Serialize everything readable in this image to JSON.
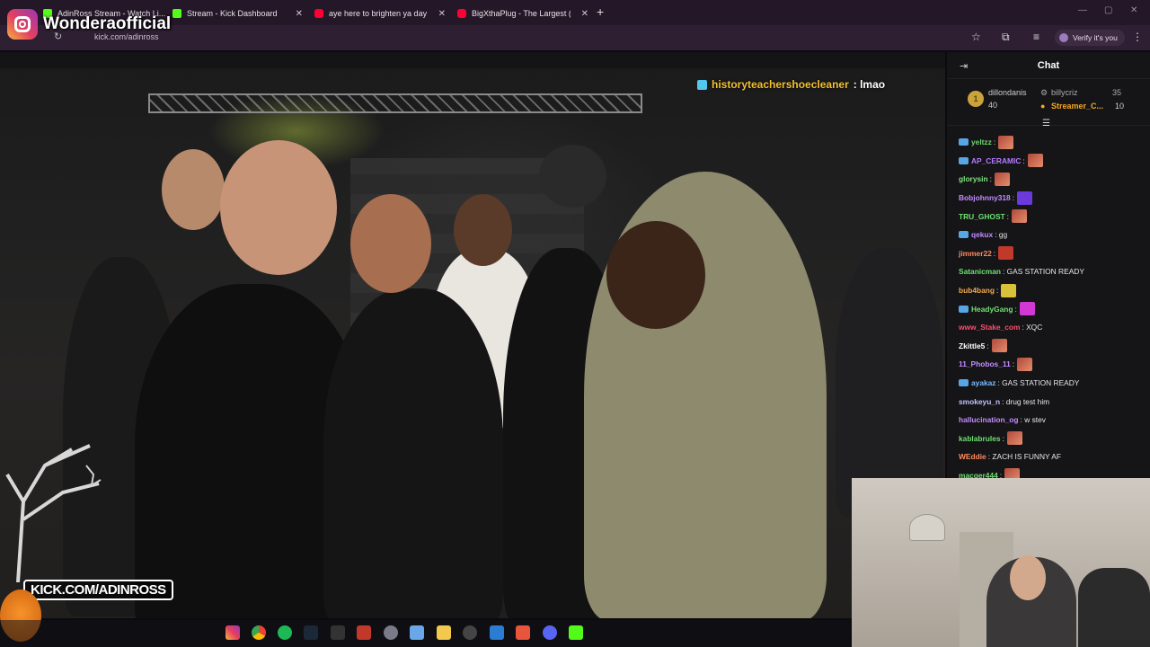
{
  "instagram": {
    "handle": "Wonderaofficial"
  },
  "browser": {
    "tabs": [
      {
        "label": "AdinRoss Stream - Watch Li...",
        "color": "#53fc18"
      },
      {
        "label": "Stream - Kick Dashboard",
        "color": "#53fc18"
      },
      {
        "label": "aye here to brighten ya day - Y...",
        "color": "#ff0033"
      },
      {
        "label": "BigXthaPlug - The Largest (Offi...",
        "color": "#ff0033"
      }
    ],
    "new_tab": "+",
    "url": "kick.com/adinross",
    "verify_label": "Verify it's you"
  },
  "stream": {
    "overlay_user": "historyteachershoecleaner",
    "overlay_text": ": lmao",
    "kick_banner": "KICK.COM/ADINROSS"
  },
  "chat": {
    "title": "Chat",
    "leaderboard": [
      {
        "name": "dillondanis",
        "count": "40",
        "rank": "1"
      },
      {
        "name": "billycriz",
        "count": "35"
      },
      {
        "name": "Streamer_C...",
        "count": "10"
      }
    ],
    "messages": [
      {
        "user": "yeltzz",
        "text": ":",
        "color": "#6fd36f",
        "emote": true,
        "badge": true
      },
      {
        "user": "AP_CERAMIC",
        "text": ":",
        "color": "#b47bff",
        "emote": true,
        "badge": true
      },
      {
        "user": "glorysin",
        "text": ":",
        "color": "#7fe37f",
        "emote": true
      },
      {
        "user": "Bobjohnny318",
        "text": ":",
        "color": "#c38cff",
        "emote": true
      },
      {
        "user": "TRU_GHOST",
        "text": ":",
        "color": "#6fe06f",
        "emote": true
      },
      {
        "user": "qekux",
        "text": ": gg",
        "color": "#c38cff",
        "badge": true
      },
      {
        "user": "jimmer22",
        "text": ":",
        "color": "#ff8a5c",
        "emote": true
      },
      {
        "user": "Satanicman",
        "text": ": GAS STATION READY",
        "color": "#6fe06f"
      },
      {
        "user": "bub4bang",
        "text": ":",
        "color": "#f0a84a",
        "emote": true
      },
      {
        "user": "HeadyGang",
        "text": ":",
        "color": "#6fe06f",
        "emote": true,
        "badge": true
      },
      {
        "user": "www_Stake_com",
        "text": ": XQC",
        "color": "#ff4d6d"
      },
      {
        "user": "Zkittle5",
        "text": ":",
        "color": "#ffffff",
        "emote": true
      },
      {
        "user": "11_Phobos_11",
        "text": ":",
        "color": "#c38cff",
        "emote": true
      },
      {
        "user": "ayakaz",
        "text": ": GAS STATION READY",
        "color": "#7ab8ff",
        "badge": true
      },
      {
        "user": "smokeyu_n",
        "text": ": drug test him",
        "color": "#c2c2ff"
      },
      {
        "user": "hallucination_og",
        "text": ": w stev",
        "color": "#c38cff"
      },
      {
        "user": "kablabrules",
        "text": ":",
        "color": "#6fe06f",
        "emote": true
      },
      {
        "user": "WEddie",
        "text": ": ZACH IS FUNNY AF",
        "color": "#ff8a5c"
      },
      {
        "user": "macger444",
        "text": ":",
        "color": "#6fe06f",
        "emote": true
      }
    ]
  }
}
